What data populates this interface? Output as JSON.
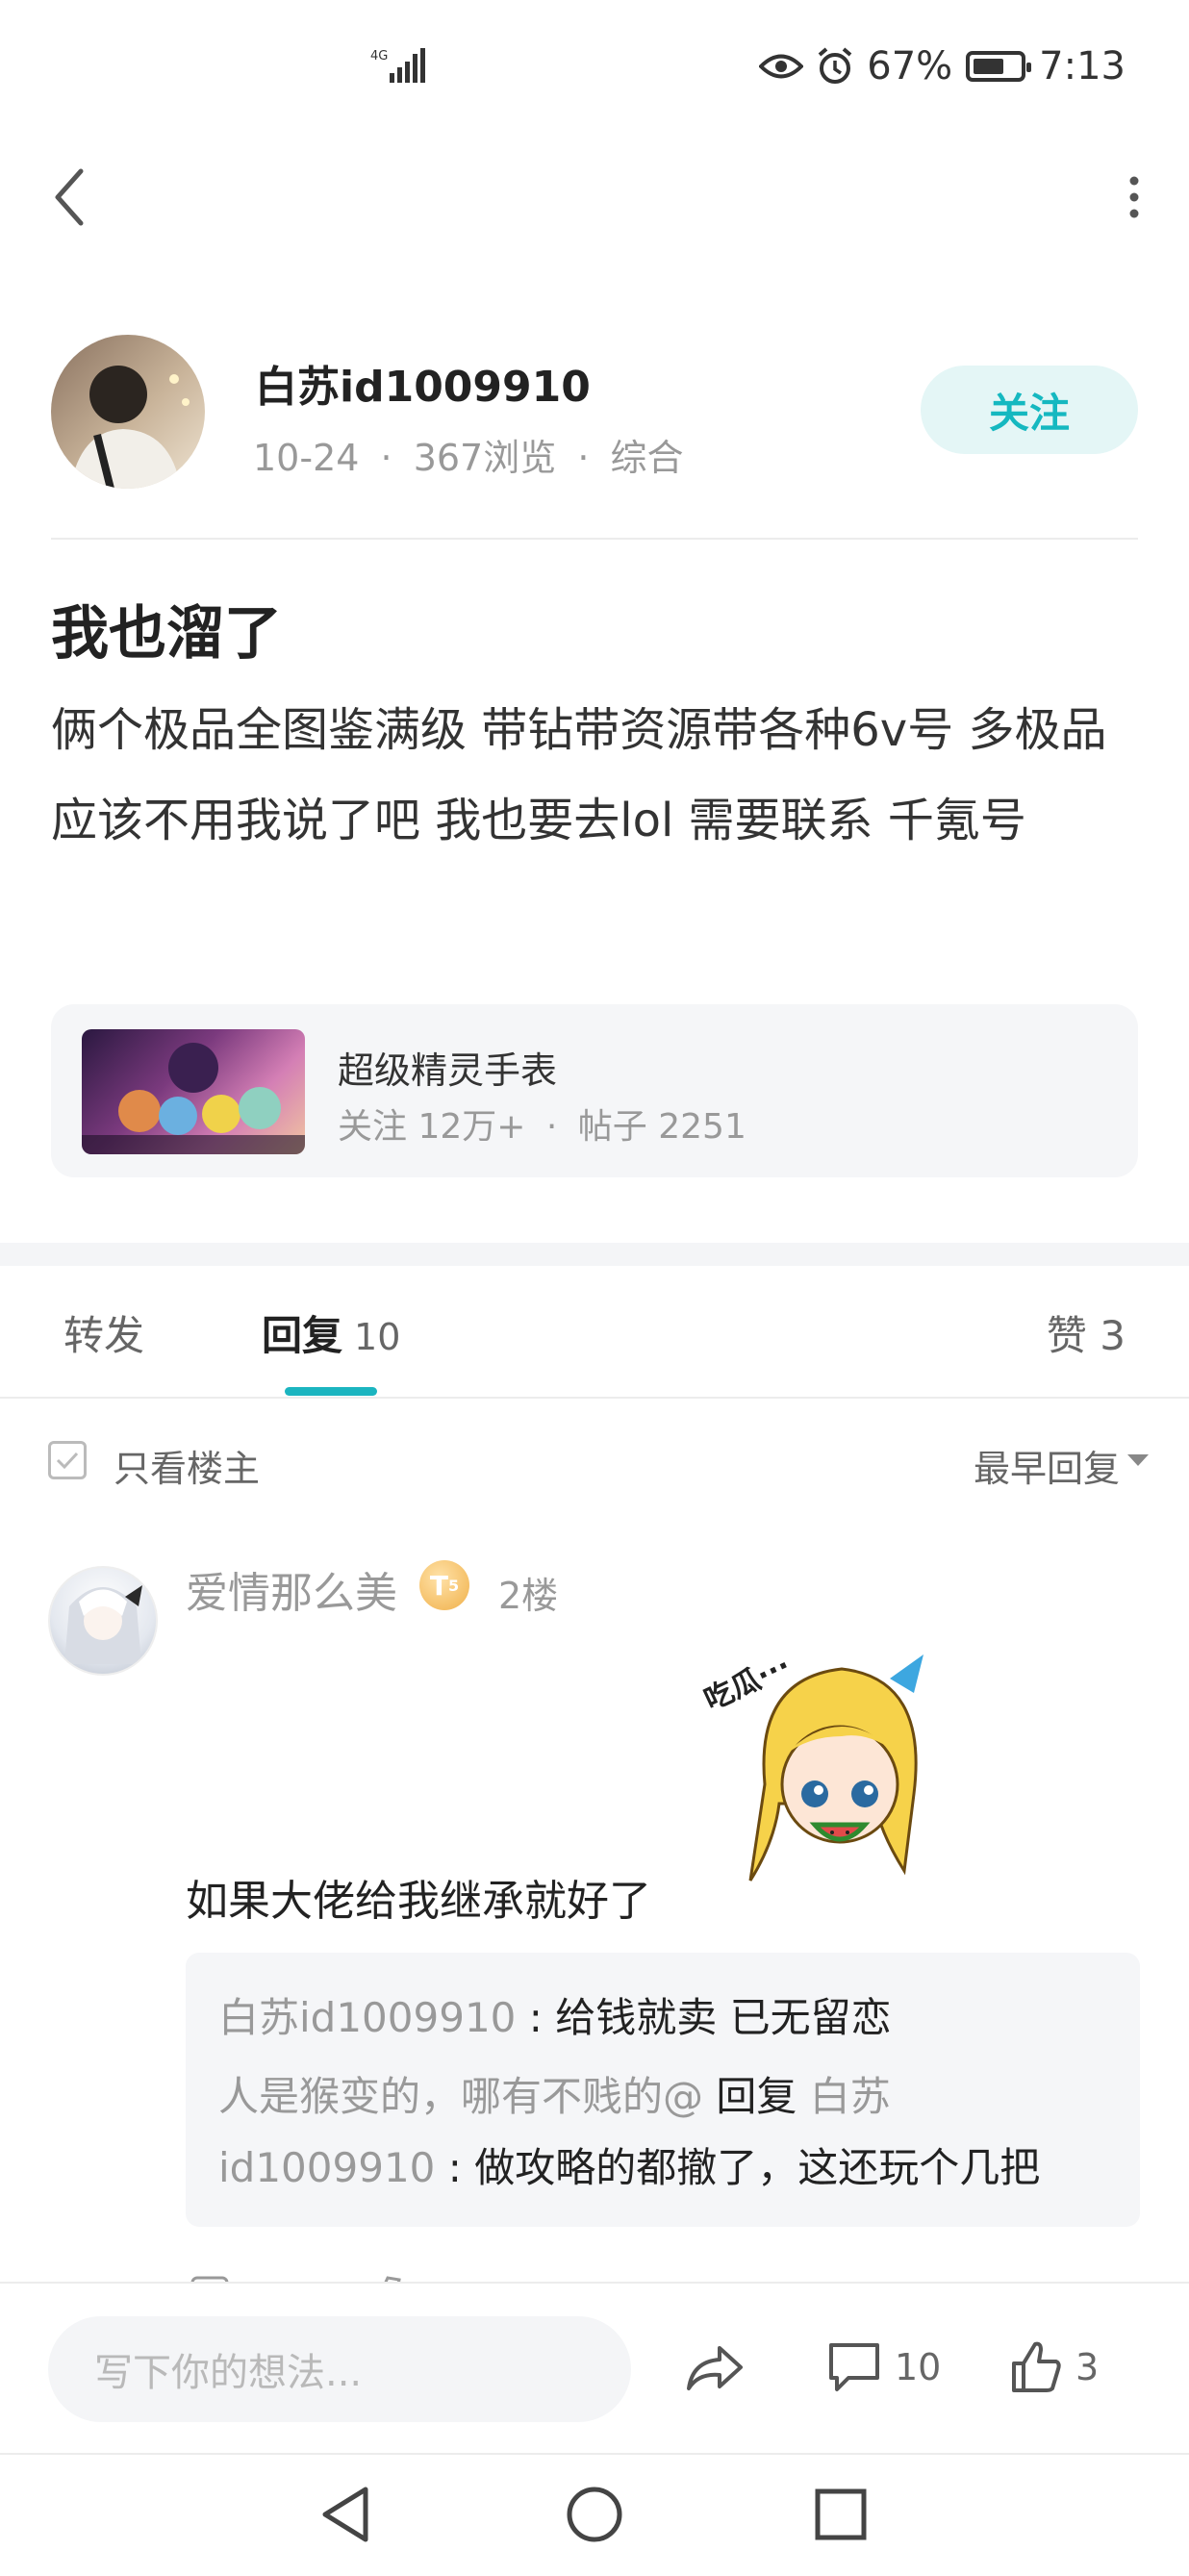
{
  "status_bar": {
    "network": "4G",
    "battery": "67%",
    "battery_level": 0.67,
    "time": "7:13",
    "icons": [
      "signal-icon",
      "eye-icon",
      "alarm-icon",
      "battery-icon"
    ]
  },
  "nav": {
    "back_icon": "chevron-left-icon",
    "more_icon": "more-vertical-icon"
  },
  "author": {
    "name": "白苏id1009910",
    "date": "10-24",
    "views": "367浏览",
    "category": "综合",
    "separator": "·",
    "follow_label": "关注"
  },
  "post": {
    "title": "我也溜了",
    "body": "俩个极品全图鉴满级 带钻带资源带各种6v号 多极品应该不用我说了吧 我也要去lol 需要联系 千氪号"
  },
  "forum": {
    "name": "超级精灵手表",
    "followers": "关注 12万+",
    "posts": "帖子 2251",
    "separator": "·"
  },
  "tabs": {
    "repost": "转发",
    "reply": "回复",
    "reply_count": "10",
    "like": "赞 3"
  },
  "filter": {
    "only_op": "只看楼主",
    "sort": "最早回复"
  },
  "reply": {
    "user": "爱情那么美",
    "level_badge": "T",
    "level_num": "5",
    "floor": "2楼",
    "sticker_text": "吃瓜···",
    "text": "如果大佬给我继承就好了",
    "quote": {
      "line1_user": "白苏id1009910",
      "line1_text": " : 给钱就卖 已无留恋",
      "line2_user": "人是猴变的，哪有不贱的@",
      "line2_reply": " 回复 ",
      "line2_target": "白苏",
      "line3_target": "id1009910",
      "line3_text": " : 做攻略的都撤了，这还玩个几把"
    }
  },
  "bottom_bar": {
    "input_placeholder": "写下你的想法...",
    "comment_count": "10",
    "like_count": "3"
  },
  "system_nav": {
    "icons": [
      "back-triangle-icon",
      "home-circle-icon",
      "recent-square-icon"
    ]
  },
  "colors": {
    "accent": "#1bb5c0",
    "follow_bg": "#e4f6f6",
    "muted": "#999999",
    "card_bg": "#f5f6f8"
  }
}
